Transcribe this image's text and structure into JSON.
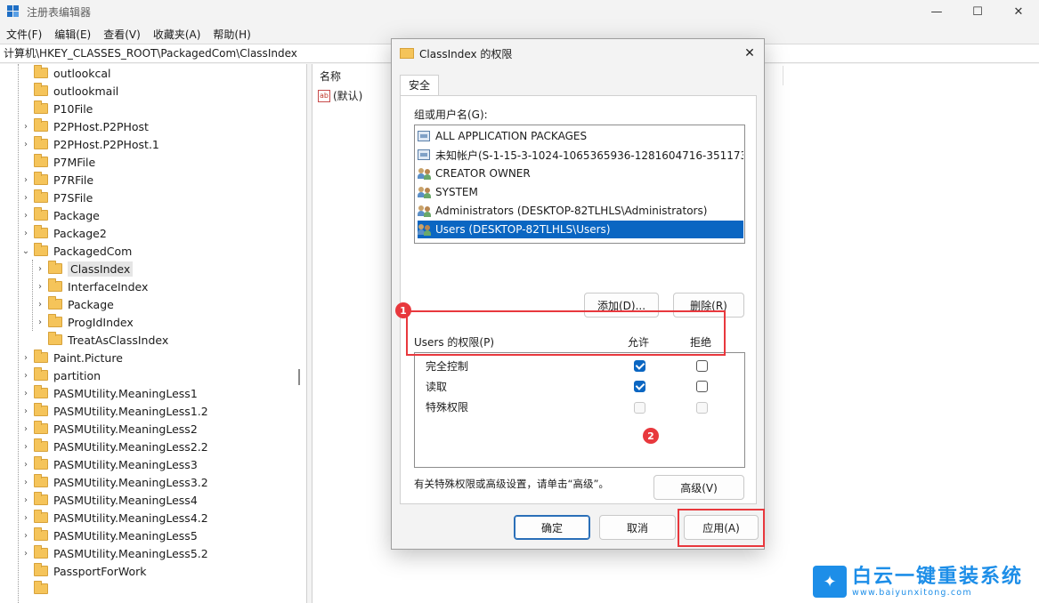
{
  "window": {
    "title": "注册表编辑器",
    "controls": {
      "minimize": "—",
      "maximize": "☐",
      "close": "✕"
    }
  },
  "menu": [
    "文件(F)",
    "编辑(E)",
    "查看(V)",
    "收藏夹(A)",
    "帮助(H)"
  ],
  "address": "计算机\\HKEY_CLASSES_ROOT\\PackagedCom\\ClassIndex",
  "tree": [
    {
      "label": "outlookcal",
      "expander": ""
    },
    {
      "label": "outlookmail",
      "expander": ""
    },
    {
      "label": "P10File",
      "expander": ""
    },
    {
      "label": "P2PHost.P2PHost",
      "expander": ">"
    },
    {
      "label": "P2PHost.P2PHost.1",
      "expander": ">"
    },
    {
      "label": "P7MFile",
      "expander": ""
    },
    {
      "label": "P7RFile",
      "expander": ">"
    },
    {
      "label": "P7SFile",
      "expander": ">"
    },
    {
      "label": "Package",
      "expander": ">"
    },
    {
      "label": "Package2",
      "expander": ">"
    },
    {
      "label": "PackagedCom",
      "expander": "v"
    },
    {
      "label": "ClassIndex",
      "expander": ">"
    },
    {
      "label": "InterfaceIndex",
      "expander": ">"
    },
    {
      "label": "Package",
      "expander": ">"
    },
    {
      "label": "ProgIdIndex",
      "expander": ">"
    },
    {
      "label": "TreatAsClassIndex",
      "expander": ""
    },
    {
      "label": "Paint.Picture",
      "expander": ">"
    },
    {
      "label": "partition",
      "expander": ">"
    },
    {
      "label": "PASMUtility.MeaningLess1",
      "expander": ">"
    },
    {
      "label": "PASMUtility.MeaningLess1.2",
      "expander": ">"
    },
    {
      "label": "PASMUtility.MeaningLess2",
      "expander": ">"
    },
    {
      "label": "PASMUtility.MeaningLess2.2",
      "expander": ">"
    },
    {
      "label": "PASMUtility.MeaningLess3",
      "expander": ">"
    },
    {
      "label": "PASMUtility.MeaningLess3.2",
      "expander": ">"
    },
    {
      "label": "PASMUtility.MeaningLess4",
      "expander": ">"
    },
    {
      "label": "PASMUtility.MeaningLess4.2",
      "expander": ">"
    },
    {
      "label": "PASMUtility.MeaningLess5",
      "expander": ">"
    },
    {
      "label": "PASMUtility.MeaningLess5.2",
      "expander": ">"
    },
    {
      "label": "PassportForWork",
      "expander": ""
    }
  ],
  "values": {
    "header_name": "名称",
    "row_icon": "ab",
    "row_name": "(默认)"
  },
  "dialog": {
    "title": "ClassIndex 的权限",
    "close": "✕",
    "tab": "安全",
    "group_label": "组或用户名(G):",
    "users": [
      {
        "name": "ALL APPLICATION PACKAGES",
        "icon": "package-icon"
      },
      {
        "name": "未知帐户(S-1-15-3-1024-1065365936-1281604716-351173...",
        "icon": "unknown-account-icon"
      },
      {
        "name": "CREATOR OWNER",
        "icon": "users-icon"
      },
      {
        "name": "SYSTEM",
        "icon": "users-icon"
      },
      {
        "name": "Administrators (DESKTOP-82TLHLS\\Administrators)",
        "icon": "users-icon"
      },
      {
        "name": "Users (DESKTOP-82TLHLS\\Users)",
        "icon": "users-icon",
        "selected": true
      }
    ],
    "add_button": "添加(D)...",
    "remove_button": "删除(R)",
    "perm_label": "Users 的权限(P)",
    "allow_header": "允许",
    "deny_header": "拒绝",
    "permissions": [
      {
        "name": "完全控制",
        "allow": true,
        "deny": false,
        "disabled": false
      },
      {
        "name": "读取",
        "allow": true,
        "deny": false,
        "disabled": false
      },
      {
        "name": "特殊权限",
        "allow": false,
        "deny": false,
        "disabled": true
      }
    ],
    "advanced_hint": "有关特殊权限或高级设置，请单击“高级”。",
    "advanced_button": "高级(V)",
    "ok_button": "确定",
    "cancel_button": "取消",
    "apply_button": "应用(A)"
  },
  "annotations": {
    "badge1": "1",
    "badge2": "2",
    "color": "#e8383d"
  },
  "watermark": {
    "cn": "白云一键重装系统",
    "en": "www.baiyunxitong.com"
  }
}
